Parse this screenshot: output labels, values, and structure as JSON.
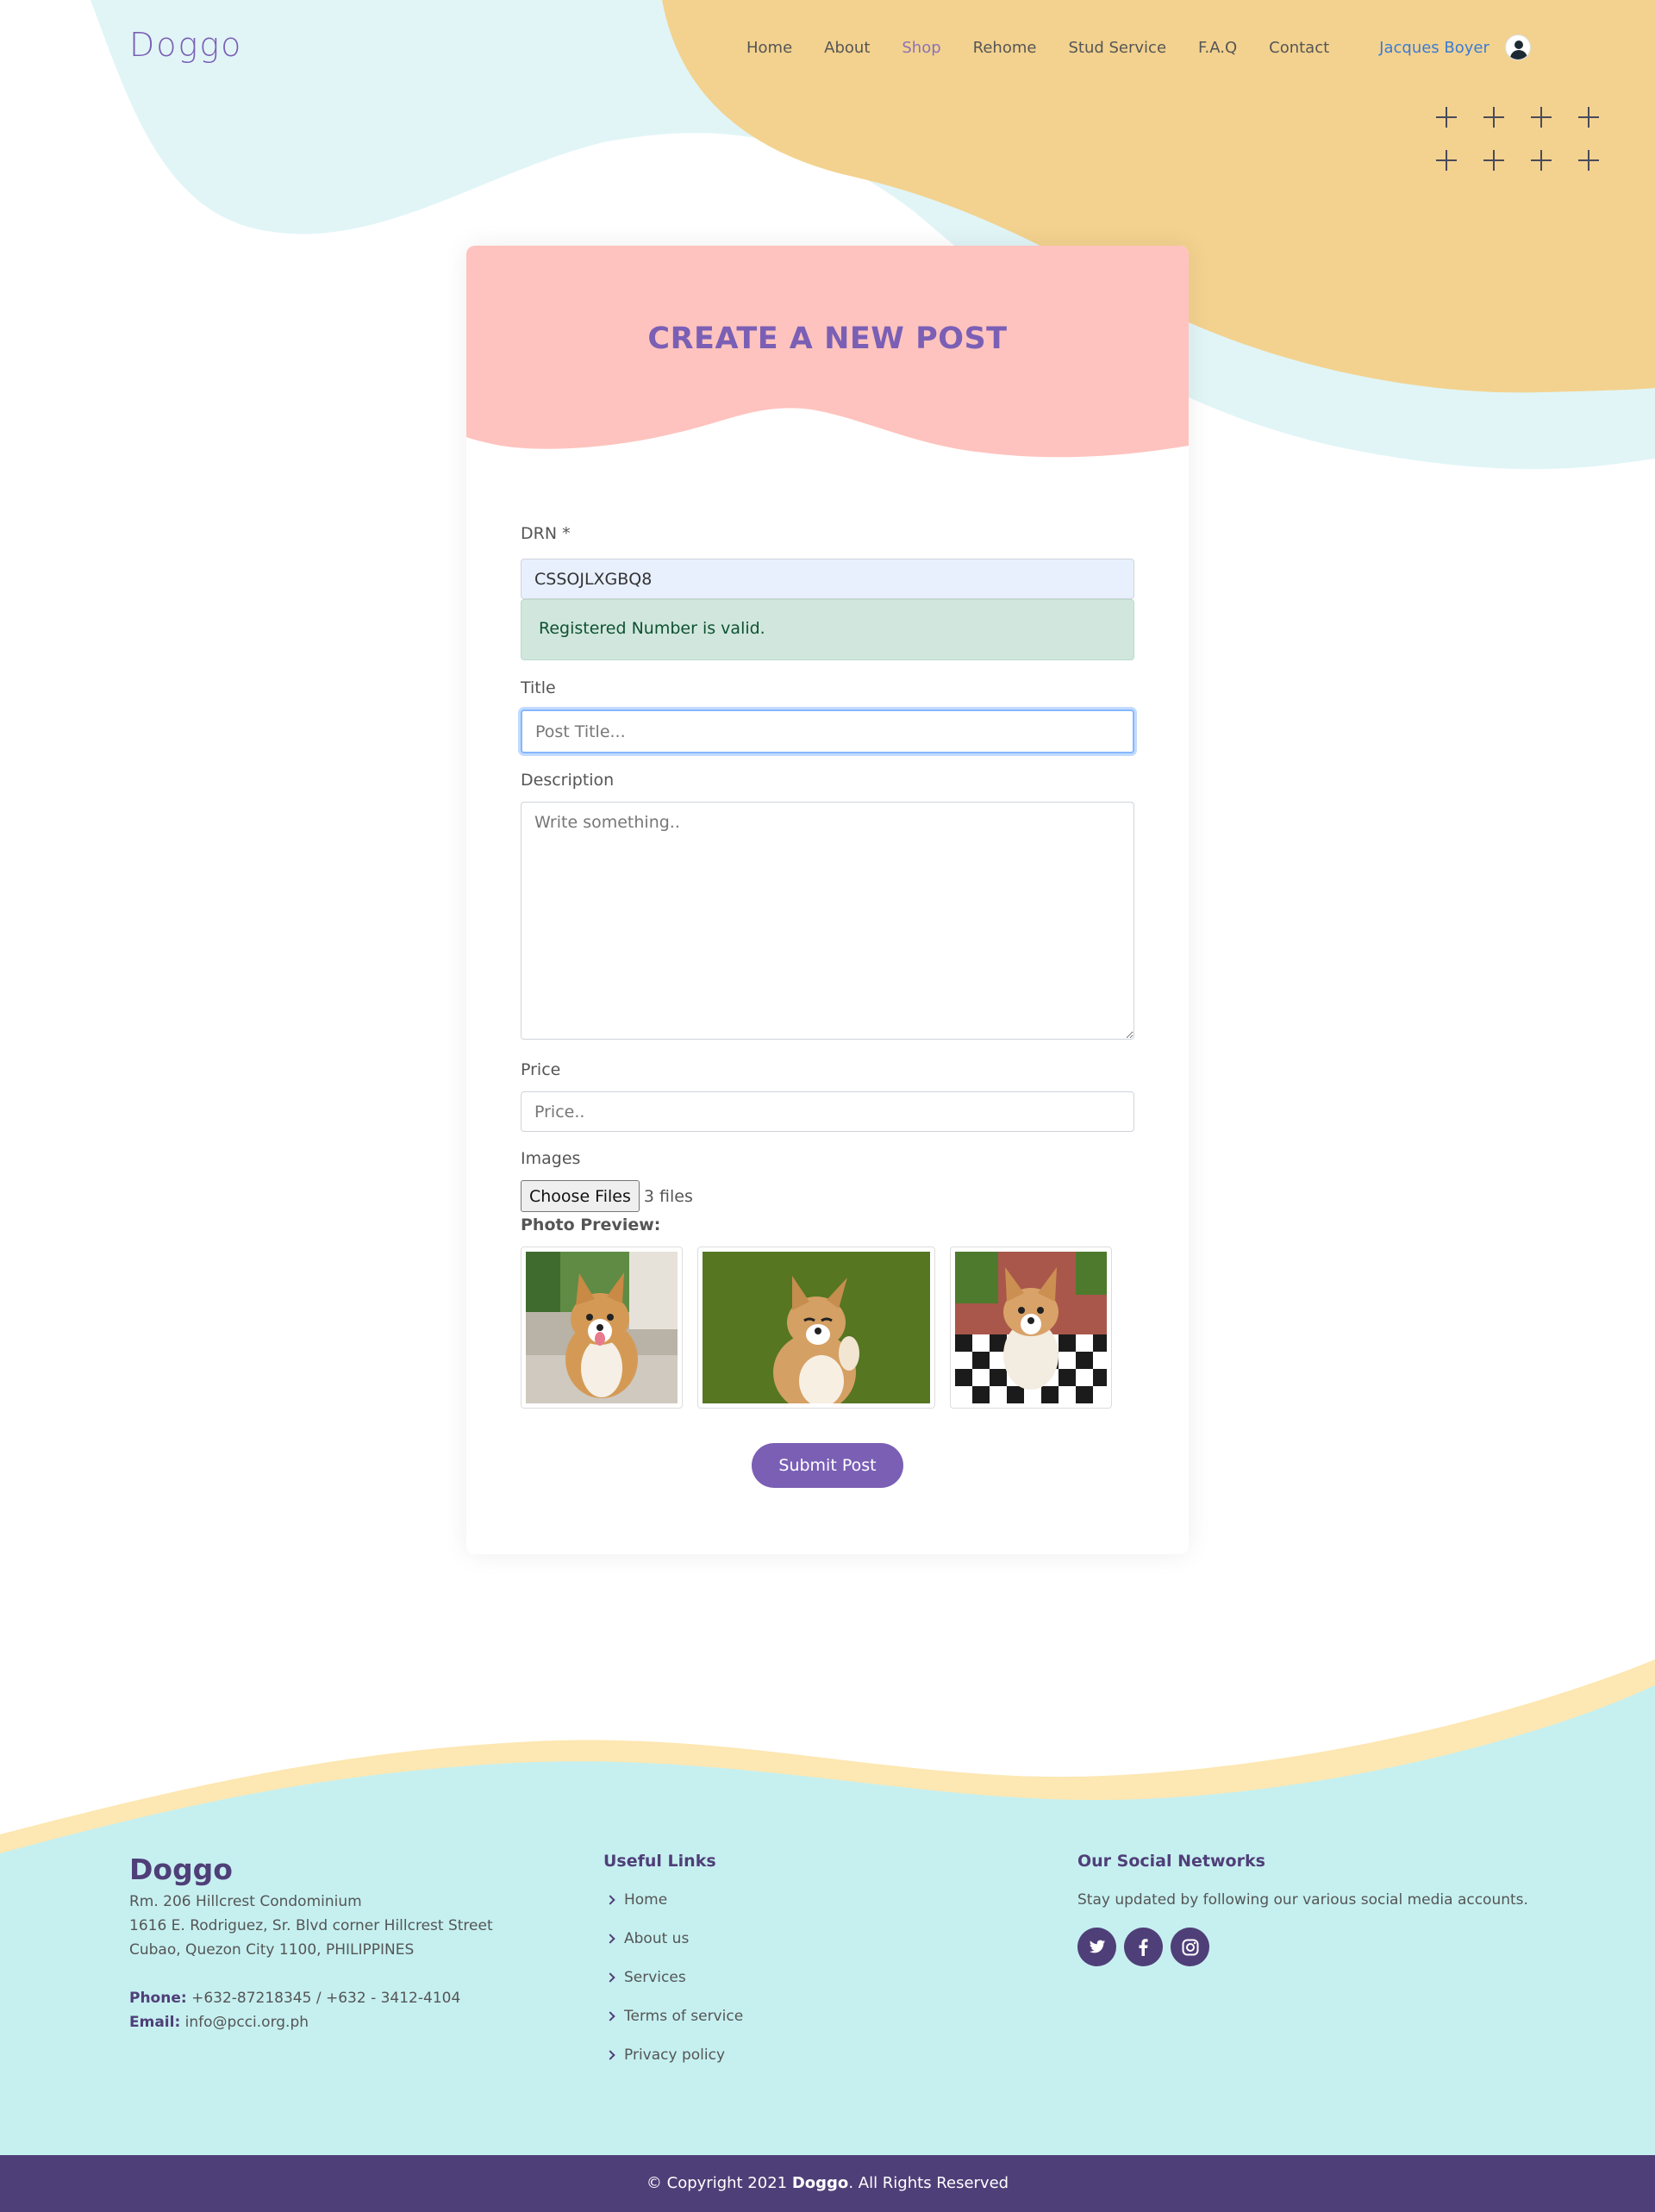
{
  "brand": {
    "name": "Doggo"
  },
  "nav": {
    "items": [
      {
        "label": "Home"
      },
      {
        "label": "About"
      },
      {
        "label": "Shop"
      },
      {
        "label": "Rehome"
      },
      {
        "label": "Stud Service"
      },
      {
        "label": "F.A.Q"
      },
      {
        "label": "Contact"
      }
    ],
    "active": "Shop",
    "user_name": "Jacques Boyer"
  },
  "form": {
    "title": "CREATE A NEW POST",
    "drn": {
      "label": "DRN *",
      "value": "CSSOJLXGBQ8"
    },
    "drn_alert": "Registered Number is valid.",
    "post_title": {
      "label": "Title",
      "placeholder": "Post Title..."
    },
    "description": {
      "label": "Description",
      "placeholder": "Write something.."
    },
    "price": {
      "label": "Price",
      "placeholder": "Price.."
    },
    "images": {
      "label": "Images",
      "button": "Choose Files",
      "count": "3 files"
    },
    "preview_label": "Photo Preview:",
    "submit": "Submit Post"
  },
  "footer": {
    "brand": "Doggo",
    "address": [
      "Rm. 206 Hillcrest Condominium",
      "1616 E. Rodriguez, Sr. Blvd corner Hillcrest Street",
      "Cubao, Quezon City 1100, PHILIPPINES"
    ],
    "phone_label": "Phone:",
    "phone": "+632-87218345 / +632 - 3412-4104",
    "email_label": "Email:",
    "email": "info@pcci.org.ph",
    "links_heading": "Useful Links",
    "links": [
      "Home",
      "About us",
      "Services",
      "Terms of service",
      "Privacy policy"
    ],
    "social_heading": "Our Social Networks",
    "social_text": "Stay updated by following our various social media accounts.",
    "social_icons": [
      "twitter-icon",
      "facebook-icon",
      "instagram-icon"
    ],
    "copyright_prefix": "© Copyright 2021",
    "copyright_brand": "Doggo",
    "copyright_suffix": ". All Rights Reserved"
  },
  "colors": {
    "accent_purple": "#7a5fb5",
    "footer_purple": "#4f3f78",
    "header_blob_yellow": "#f3d28f",
    "header_blob_blue": "#e1f5f7",
    "card_header_pink": "#fec3be",
    "footer_bg": "#c6f0f0",
    "footer_wave_yellow": "#fde7b2"
  }
}
